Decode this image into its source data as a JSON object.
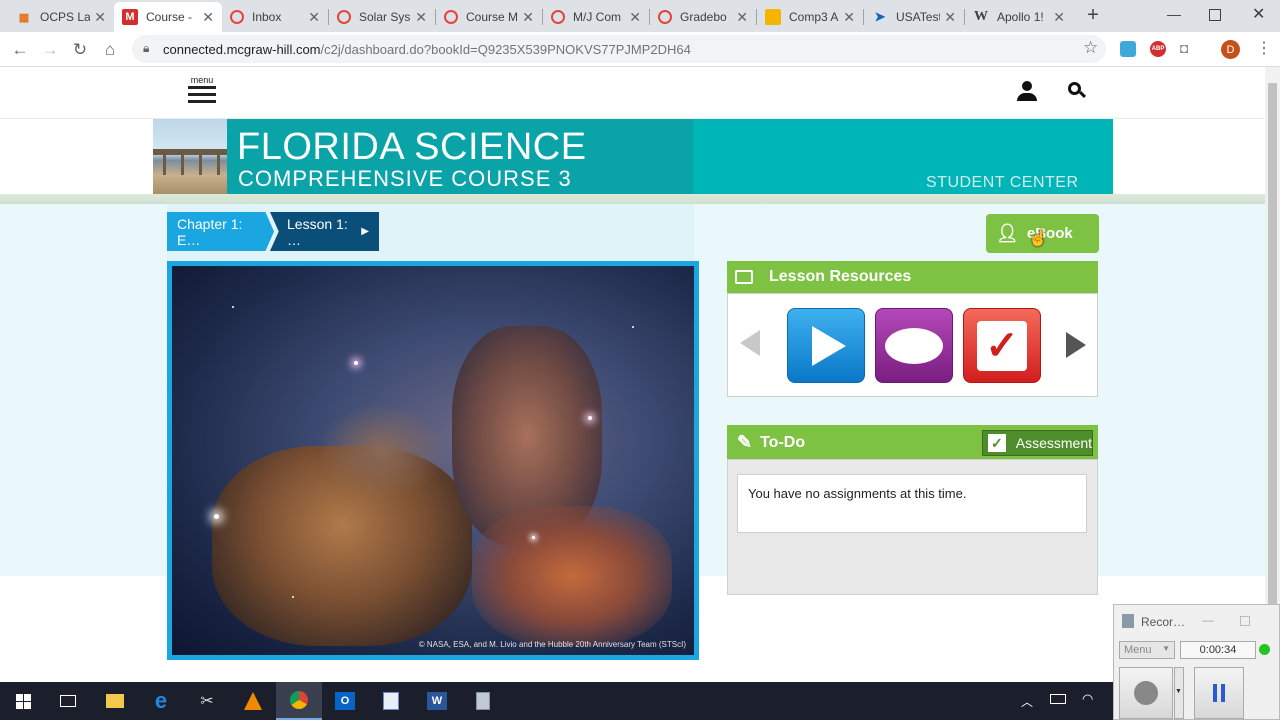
{
  "browser": {
    "tabs": [
      {
        "title": "OCPS La",
        "icon": "ocps-icon"
      },
      {
        "title": "Course -",
        "icon": "mcgraw-hill-icon",
        "active": true
      },
      {
        "title": "Inbox",
        "icon": "ring-icon"
      },
      {
        "title": "Solar Sys",
        "icon": "ring-icon"
      },
      {
        "title": "Course M",
        "icon": "ring-icon"
      },
      {
        "title": "M/J Com",
        "icon": "ring-icon"
      },
      {
        "title": "Gradebo",
        "icon": "ring-icon"
      },
      {
        "title": "Comp3 A",
        "icon": "slides-icon"
      },
      {
        "title": "USATestp",
        "icon": "cursor-icon"
      },
      {
        "title": "Apollo 1!",
        "icon": "wikipedia-icon"
      }
    ],
    "new_tab": "+",
    "url_host": "connected.mcgraw-hill.com",
    "url_path": "/c2j/dashboard.do?bookId=Q9235X539PNOKVS77PJMP2DH64",
    "profile_initial": "D"
  },
  "header": {
    "menu_label": "menu"
  },
  "banner": {
    "title": "FLORIDA SCIENCE",
    "subtitle": "COMPREHENSIVE COURSE 3",
    "center_label": "STUDENT CENTER"
  },
  "breadcrumb": {
    "chapter": "Chapter 1: E…",
    "lesson": "Lesson 1: …"
  },
  "hero": {
    "credit": "© NASA, ESA, and M. Livio and the Hubble 20th Anniversary Team (STScI)"
  },
  "ebook": {
    "label": "eBook"
  },
  "lesson_resources": {
    "title": "Lesson Resources",
    "items": [
      "play-video-icon",
      "discussion-bubble-icon",
      "checkmark-quiz-icon"
    ]
  },
  "todo": {
    "title": "To-Do",
    "assessment_label": "Assessment",
    "message": "You have no assignments at this time."
  },
  "recorder": {
    "title": "Recor…",
    "menu_label": "Menu",
    "time": "0:00:34"
  },
  "colors": {
    "accent_green": "#7dc242",
    "banner_teal": "#00b5b8",
    "crumb_blue": "#1aa6e0",
    "crumb_dark": "#0a4f7a"
  }
}
